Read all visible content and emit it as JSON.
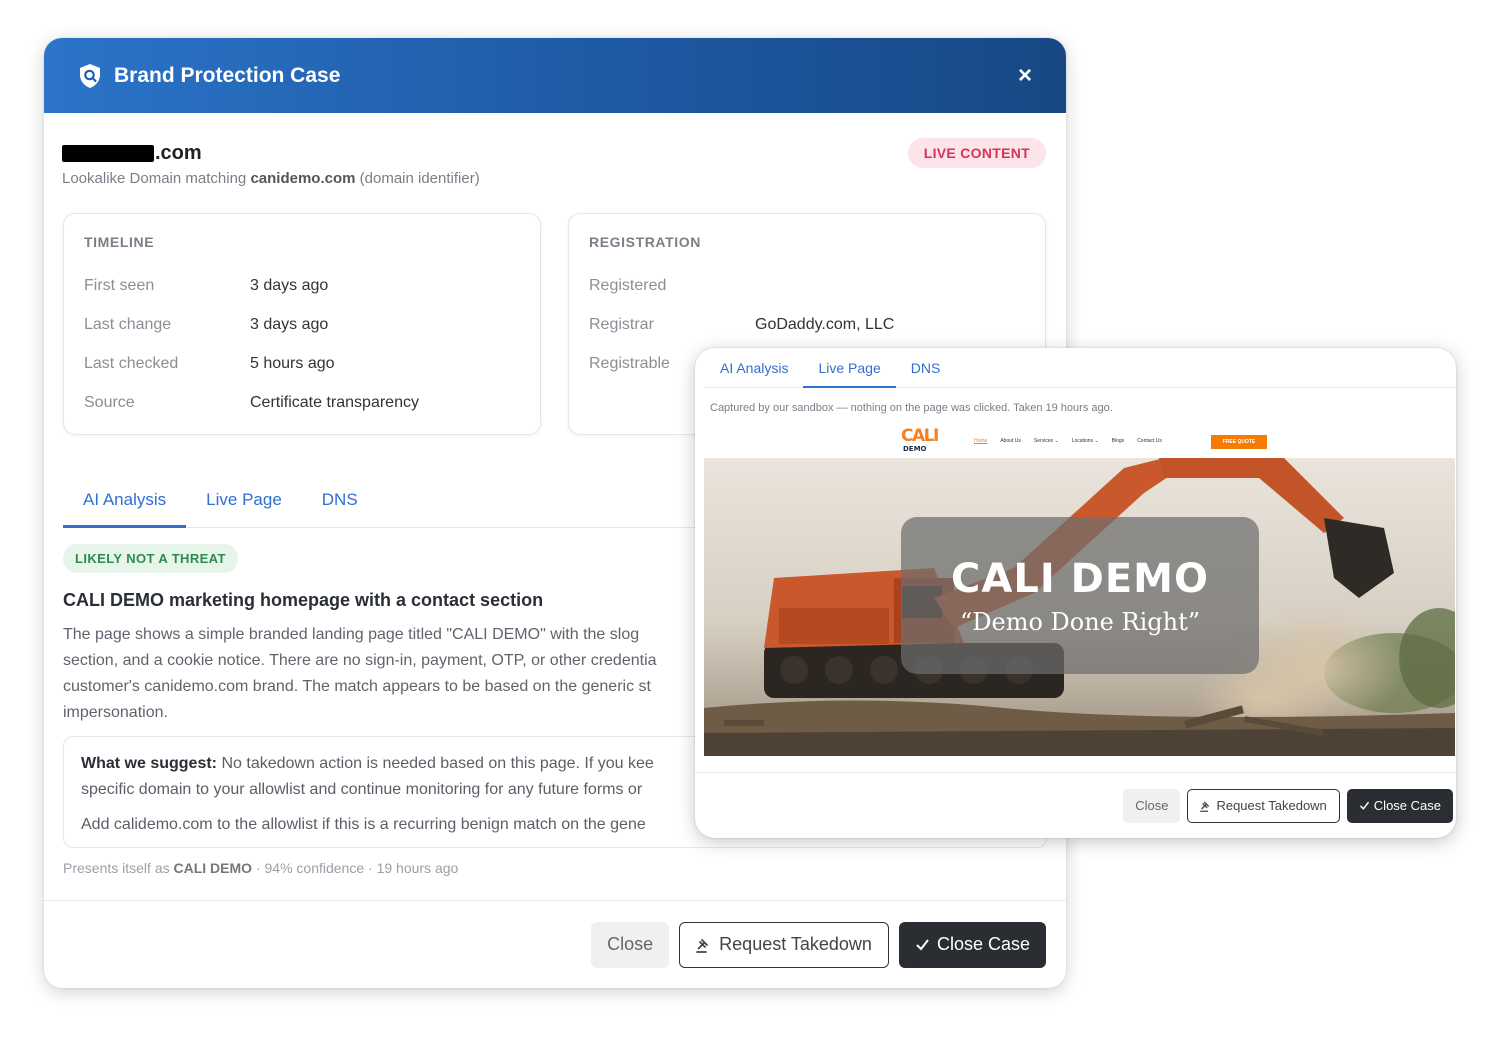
{
  "modal": {
    "title": "Brand Protection Case",
    "close_icon": "×",
    "domain_tld": ".com",
    "live_badge": "LIVE CONTENT",
    "lookalike_prefix": "Lookalike Domain matching",
    "lookalike_domain": "canidemo.com",
    "lookalike_suffix": "(domain identifier)",
    "timeline": {
      "title": "TIMELINE",
      "rows": [
        {
          "label": "First seen",
          "value": "3 days ago"
        },
        {
          "label": "Last change",
          "value": "3 days ago"
        },
        {
          "label": "Last checked",
          "value": "5 hours ago"
        },
        {
          "label": "Source",
          "value": "Certificate transparency"
        }
      ]
    },
    "registration": {
      "title": "REGISTRATION",
      "rows": [
        {
          "label": "Registered",
          "value": ""
        },
        {
          "label": "Registrar",
          "value": "GoDaddy.com, LLC"
        },
        {
          "label": "Registrable",
          "value": ""
        }
      ]
    },
    "tabs": [
      "AI Analysis",
      "Live Page",
      "DNS"
    ],
    "active_tab": "AI Analysis",
    "threat_badge": "LIKELY NOT A THREAT",
    "summary_title": "CALI DEMO marketing homepage with a contact section",
    "summary_lines": [
      "The page shows a simple branded landing page titled \"CALI DEMO\" with the slog",
      "section, and a cookie notice. There are no sign-in, payment, OTP, or other credentia",
      "customer's canidemo.com brand. The match appears to be based on the generic st",
      "impersonation."
    ],
    "suggest_label": "What we suggest:",
    "suggest_line1": "No takedown action is needed based on this page. If you kee",
    "suggest_line2": "specific domain to your allowlist and continue monitoring for any future forms or",
    "suggest_line3": "Add calidemo.com to the allowlist if this is a recurring benign match on the gene",
    "presents_prefix": "Presents itself as",
    "presents_name": "CALI DEMO",
    "presents_suffix": "· 94% confidence · 19 hours ago",
    "buttons": {
      "close": "Close",
      "request_takedown": "Request Takedown",
      "close_case": "Close Case"
    }
  },
  "overlay": {
    "tabs": [
      "AI Analysis",
      "Live Page",
      "DNS"
    ],
    "active_tab": "Live Page",
    "captured_text": "Captured by our sandbox — nothing on the page was clicked. Taken 19 hours ago.",
    "site": {
      "logo_top": "CALI",
      "logo_bottom": "DEMO",
      "nav_links": [
        "Home",
        "About Us",
        "Services ⌄",
        "Locations ⌄",
        "Blogs",
        "Contact Us"
      ],
      "cta": "FREE QUOTE",
      "hero_title": "CALI DEMO",
      "hero_subtitle": "“Demo Done Right”"
    },
    "buttons": {
      "close": "Close",
      "request_takedown": "Request Takedown",
      "close_case": "Close Case"
    }
  },
  "icons": {
    "shield": "shield-icon",
    "gavel": "gavel-icon",
    "check": "check-icon",
    "close": "close-icon"
  },
  "colors": {
    "header_blue": "#1e5aa4",
    "accent_blue": "#2f6fd0",
    "live_red": "#d6335a",
    "safe_green": "#2e8b4e",
    "brand_orange": "#f58220",
    "dark_button": "#2a2e33"
  }
}
